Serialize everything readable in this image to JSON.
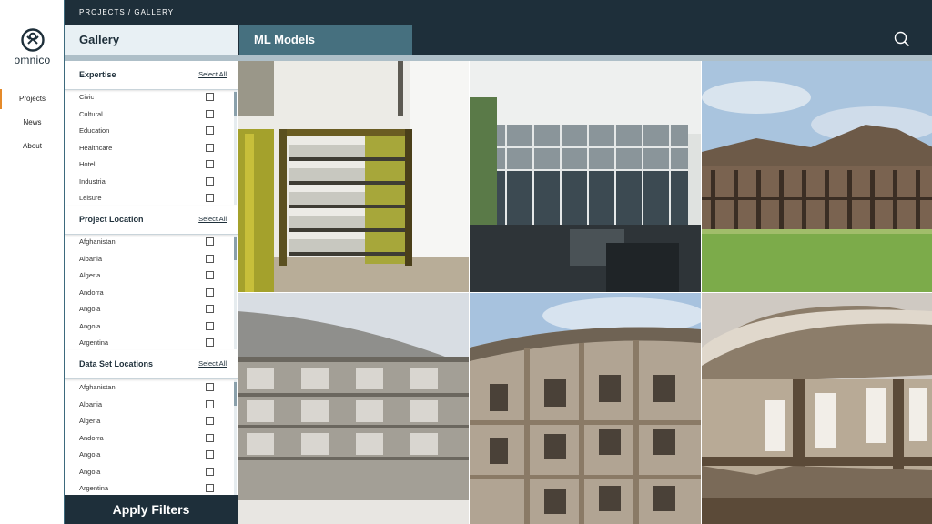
{
  "brand": {
    "name": "omnico"
  },
  "nav": {
    "items": [
      {
        "label": "Projects",
        "active": true
      },
      {
        "label": "News",
        "active": false
      },
      {
        "label": "About",
        "active": false
      }
    ]
  },
  "header": {
    "breadcrumb": "PROJECTS / GALLERY",
    "tabs": [
      {
        "label": "Gallery",
        "active": true
      },
      {
        "label": "ML Models",
        "active": false
      }
    ],
    "search_icon": "search-icon"
  },
  "filters": {
    "select_all_label": "Select All",
    "sections": [
      {
        "title": "Expertise",
        "options": [
          "Civic",
          "Cultural",
          "Education",
          "Healthcare",
          "Hotel",
          "Industrial",
          "Leisure"
        ]
      },
      {
        "title": "Project Location",
        "options": [
          "Afghanistan",
          "Albania",
          "Algeria",
          "Andorra",
          "Angola",
          "Angola",
          "Argentina"
        ]
      },
      {
        "title": "Data Set Locations",
        "options": [
          "Afghanistan",
          "Albania",
          "Algeria",
          "Andorra",
          "Angola",
          "Angola",
          "Argentina"
        ]
      }
    ],
    "apply_label": "Apply Filters"
  },
  "gallery": {
    "images": [
      {
        "kind": "yellow-frame-staircase"
      },
      {
        "kind": "glass-facade-building"
      },
      {
        "kind": "timber-roof-pavilion"
      },
      {
        "kind": "curved-roof-grid-facade"
      },
      {
        "kind": "curved-wooden-facade"
      },
      {
        "kind": "thatched-roof-house"
      }
    ]
  },
  "colors": {
    "dark": "#1e2f3a",
    "tab_inactive": "#46707f",
    "tab_active": "#e8f0f4",
    "accent": "#e58a2a",
    "strip": "#aebfc8"
  }
}
